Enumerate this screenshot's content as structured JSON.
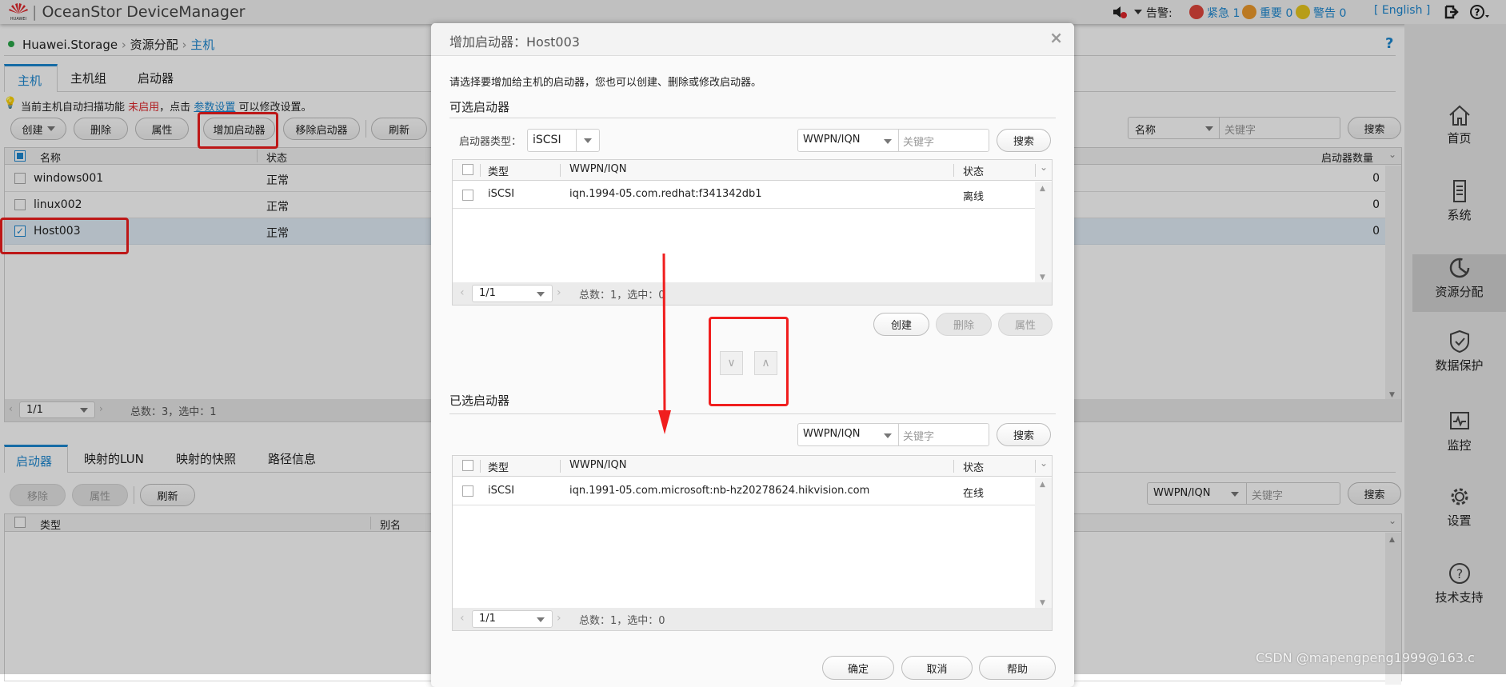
{
  "topbar": {
    "brand": "HUAWEI",
    "title": "OceanStor DeviceManager",
    "alarm_label": "告警:",
    "critical": "紧急 1",
    "major": "重要 0",
    "warning": "警告 0",
    "language": "[ English ]",
    "colors": {
      "critical": "#e0463c",
      "major": "#ee9a2c",
      "warning": "#e8c81e"
    }
  },
  "breadcrumb": {
    "items": [
      "Huawei.Storage",
      "资源分配",
      "主机"
    ],
    "help": "?"
  },
  "host_tabs": [
    "主机",
    "主机组",
    "启动器"
  ],
  "notice": {
    "prefix": "当前主机自动扫描功能",
    "status": "未启用",
    "mid": "，点击",
    "link": "参数设置",
    "suffix": "可以修改设置。"
  },
  "host_toolbar": {
    "create": "创建",
    "delete": "删除",
    "properties": "属性",
    "add_initiator": "增加启动器",
    "remove_initiator": "移除启动器",
    "refresh": "刷新",
    "search_field": "名称",
    "search_placeholder": "关键字",
    "search": "搜索"
  },
  "host_table": {
    "columns": [
      "名称",
      "状态",
      "启动器数量"
    ],
    "rows": [
      {
        "name": "windows001",
        "status": "正常",
        "count": "0",
        "checked": false
      },
      {
        "name": "linux002",
        "status": "正常",
        "count": "0",
        "checked": false
      },
      {
        "name": "Host003",
        "status": "正常",
        "count": "0",
        "checked": true
      }
    ],
    "page": "1/1",
    "summary": "总数：3，选中：1"
  },
  "detail_tabs": [
    "启动器",
    "映射的LUN",
    "映射的快照",
    "路径信息"
  ],
  "detail_toolbar": {
    "remove": "移除",
    "properties": "属性",
    "refresh": "刷新",
    "search_field": "WWPN/IQN",
    "search_placeholder": "关键字",
    "search": "搜索"
  },
  "detail_table": {
    "columns": [
      "类型",
      "别名"
    ]
  },
  "nav": [
    "首页",
    "系统",
    "资源分配",
    "数据保护",
    "监控",
    "设置",
    "技术支持"
  ],
  "dialog": {
    "title": "增加启动器：Host003",
    "instruction": "请选择要增加给主机的启动器，您也可以创建、删除或修改启动器。",
    "available_section": "可选启动器",
    "type_label": "启动器类型：",
    "type_value": "iSCSI",
    "search_field": "WWPN/IQN",
    "search_placeholder": "关键字",
    "search": "搜索",
    "columns": [
      "类型",
      "WWPN/IQN",
      "状态"
    ],
    "available_rows": [
      {
        "type": "iSCSI",
        "wwpn": "iqn.1994-05.com.redhat:f341342db1",
        "status": "离线"
      }
    ],
    "available_page": "1/1",
    "available_summary": "总数：1，选中：0",
    "create": "创建",
    "delete": "删除",
    "properties": "属性",
    "selected_section": "已选启动器",
    "selected_rows": [
      {
        "type": "iSCSI",
        "wwpn": "iqn.1991-05.com.microsoft:nb-hz20278624.hikvision.com",
        "status": "在线"
      }
    ],
    "selected_page": "1/1",
    "selected_summary": "总数：1，选中：0",
    "ok": "确定",
    "cancel": "取消",
    "help": "帮助"
  },
  "watermark": "CSDN @mapengpeng1999@163.c",
  "accent": "#1c88d2"
}
